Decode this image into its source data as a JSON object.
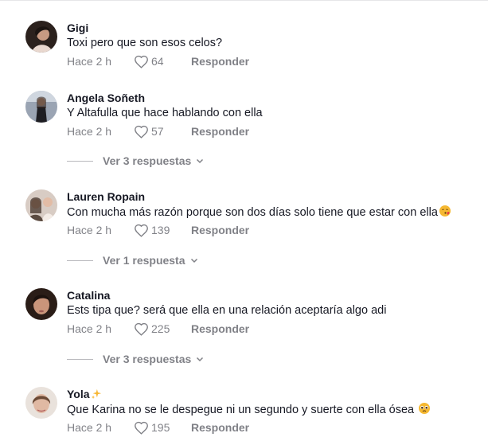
{
  "comments": [
    {
      "username": "Gigi",
      "text": "Toxi pero que son esos celos?",
      "time": "Hace 2 h",
      "likes": "64",
      "reply_label": "Responder",
      "avatar_icon": "avatar-photo-icon"
    },
    {
      "username": "Angela Soñeth",
      "text": "Y Altafulla que hace hablando con ella",
      "time": "Hace 2 h",
      "likes": "57",
      "reply_label": "Responder",
      "avatar_icon": "avatar-photo-icon",
      "view_replies": "Ver 3 respuestas"
    },
    {
      "username": "Lauren Ropain",
      "text": "Con mucha más razón porque son dos días solo tiene que estar con ella",
      "time": "Hace 2 h",
      "likes": "139",
      "reply_label": "Responder",
      "avatar_icon": "avatar-photo-icon",
      "emoji": "face-blowing-kiss-icon",
      "view_replies": "Ver 1 respuesta"
    },
    {
      "username": "Catalina",
      "text": "Ests tipa que? será que ella en una relación aceptaría algo adi",
      "time": "Hace 2 h",
      "likes": "225",
      "reply_label": "Responder",
      "avatar_icon": "avatar-photo-icon",
      "view_replies": "Ver 3 respuestas"
    },
    {
      "username": "Yola",
      "username_emoji": "sparkles-icon",
      "text": "Que Karina no se le despegue ni un segundo y suerte con ella ósea",
      "time": "Hace 2 h",
      "likes": "195",
      "reply_label": "Responder",
      "avatar_icon": "avatar-photo-icon",
      "emoji": "pleading-face-icon"
    }
  ],
  "colors": {
    "text_primary": "#161823",
    "text_secondary": "#8a8b91",
    "divider": "#e6e6e8"
  }
}
